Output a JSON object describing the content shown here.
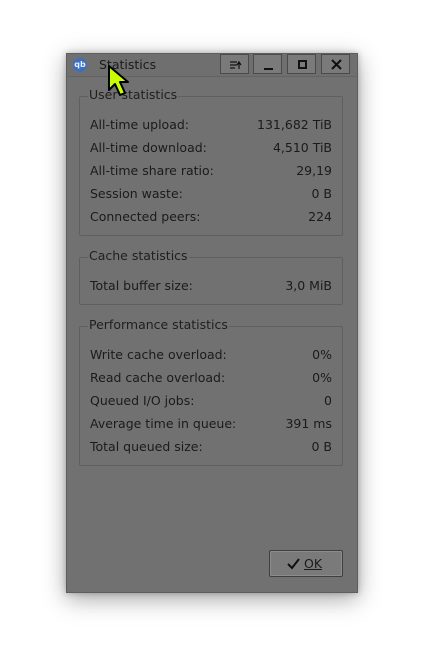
{
  "window": {
    "title": "Statistics",
    "icon": "qbittorrent-icon",
    "icon_glyph": "qb"
  },
  "titlebar_buttons": [
    {
      "name": "keep-above-button",
      "icon": "pin-menu-icon"
    },
    {
      "name": "minimize-button",
      "icon": "minimize-icon"
    },
    {
      "name": "maximize-button",
      "icon": "maximize-icon"
    },
    {
      "name": "close-button",
      "icon": "close-icon"
    }
  ],
  "user_statistics": {
    "title": "User statistics",
    "rows": [
      {
        "label": "All-time upload:",
        "value": "131,682 TiB"
      },
      {
        "label": "All-time download:",
        "value": "4,510 TiB"
      },
      {
        "label": "All-time share ratio:",
        "value": "29,19"
      },
      {
        "label": "Session waste:",
        "value": "0 B"
      },
      {
        "label": "Connected peers:",
        "value": "224"
      }
    ]
  },
  "cache_statistics": {
    "title": "Cache statistics",
    "rows": [
      {
        "label": "Total buffer size:",
        "value": "3,0 MiB"
      }
    ]
  },
  "performance_statistics": {
    "title": "Performance statistics",
    "rows": [
      {
        "label": "Write cache overload:",
        "value": "0%"
      },
      {
        "label": "Read cache overload:",
        "value": "0%"
      },
      {
        "label": "Queued I/O jobs:",
        "value": "0"
      },
      {
        "label": "Average time in queue:",
        "value": "391 ms"
      },
      {
        "label": "Total queued size:",
        "value": "0 B"
      }
    ]
  },
  "ok_button": {
    "label": "OK",
    "icon": "checkmark-icon"
  },
  "colors": {
    "window_bg": "#717171",
    "text": "#1b1b1b",
    "cursor_fill": "#c8ff00"
  }
}
